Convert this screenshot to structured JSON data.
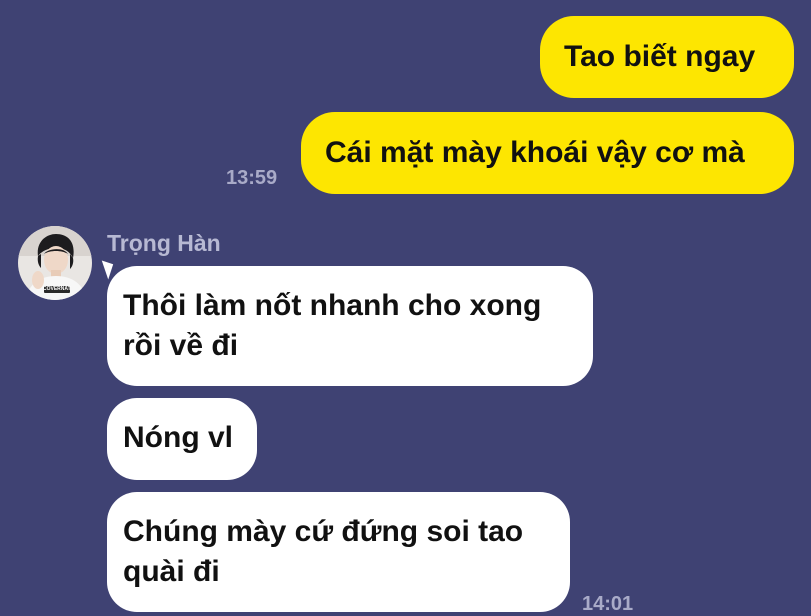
{
  "conversation": {
    "outgoing": [
      {
        "text": "Tao biết ngay"
      },
      {
        "text": "Cái mặt mày khoái vậy cơ mà"
      }
    ],
    "outgoing_time": "13:59",
    "sender": {
      "name": "Trọng Hàn",
      "avatar_caption": "COVERNAT"
    },
    "incoming": [
      {
        "line1": "Thôi làm nốt nhanh cho xong",
        "line2": "rồi về đi"
      },
      {
        "line1": "Nóng vl"
      },
      {
        "line1": "Chúng mày cứ đứng soi tao",
        "line2": "quài đi"
      }
    ],
    "incoming_time": "14:01"
  },
  "colors": {
    "background": "#3f4273",
    "outgoing_bubble": "#fde601",
    "incoming_bubble": "#ffffff",
    "timestamp": "#a9abc8"
  },
  "icons": {
    "avatar": "profile-photo"
  }
}
